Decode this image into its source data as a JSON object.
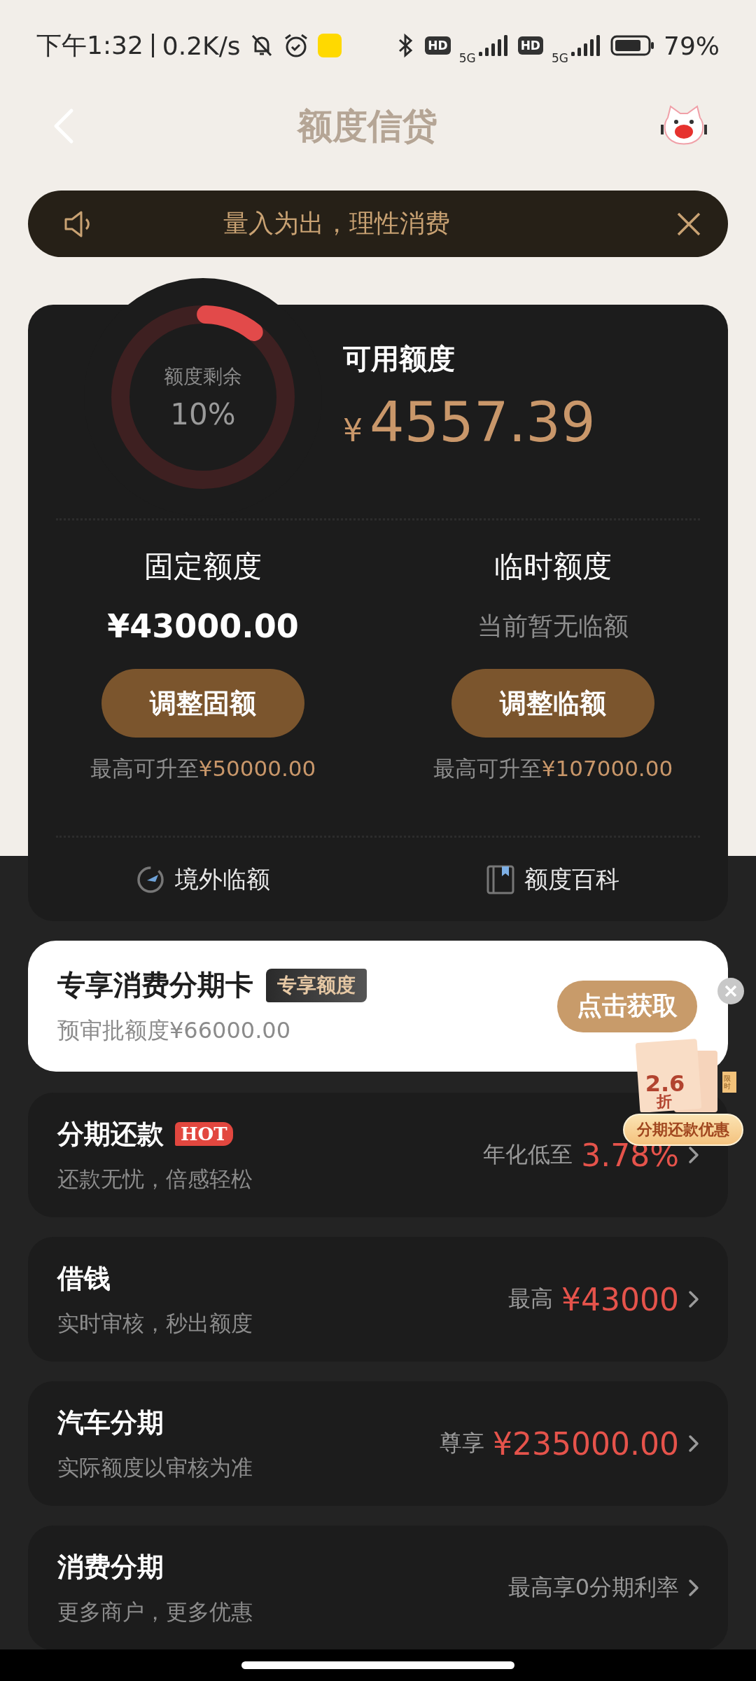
{
  "status_bar": {
    "time": "下午1:32",
    "speed": "0.2K/s",
    "sims": [
      {
        "hd": "HD",
        "network": "5G"
      },
      {
        "hd": "HD",
        "network": "5G"
      }
    ],
    "battery": "79%"
  },
  "header": {
    "title": "额度信贷"
  },
  "notice": {
    "text": "量入为出，理性消费"
  },
  "credit": {
    "ring_label": "额度剩余",
    "ring_value": "10%",
    "level": 0.1,
    "available_label": "可用额度",
    "currency": "¥",
    "available_amount": "4557.39"
  },
  "limits": [
    {
      "kind": "amount",
      "title": "固定额度",
      "value": "¥43000.00",
      "button": "调整固额",
      "max_prefix": "最高可升至",
      "max_value": "¥50000.00"
    },
    {
      "kind": "note",
      "title": "临时额度",
      "value": "当前暂无临额",
      "button": "调整临额",
      "max_prefix": "最高可升至",
      "max_value": "¥107000.00"
    }
  ],
  "links": [
    {
      "label": "境外临额"
    },
    {
      "label": "额度百科"
    }
  ],
  "promo": {
    "title": "专享消费分期卡",
    "tag": "专享额度",
    "subtitle": "预审批额度¥66000.00",
    "button": "点击获取"
  },
  "sticker": {
    "discount": "2.6",
    "unit": "折",
    "side_label": "限时",
    "caption": "分期还款优惠"
  },
  "products": [
    {
      "title": "分期还款",
      "badge": "HOT",
      "subtitle": "还款无忧，倍感轻松",
      "prefix": "年化低至",
      "highlight": "3.78%"
    },
    {
      "title": "借钱",
      "subtitle": "实时审核，秒出额度",
      "prefix": "最高",
      "highlight": "¥43000"
    },
    {
      "title": "汽车分期",
      "subtitle": "实际额度以审核为准",
      "prefix": "尊享",
      "highlight": "¥235000.00"
    },
    {
      "title": "消费分期",
      "subtitle": "更多商户，更多优惠",
      "prefix": "最高享0分期利率"
    }
  ]
}
